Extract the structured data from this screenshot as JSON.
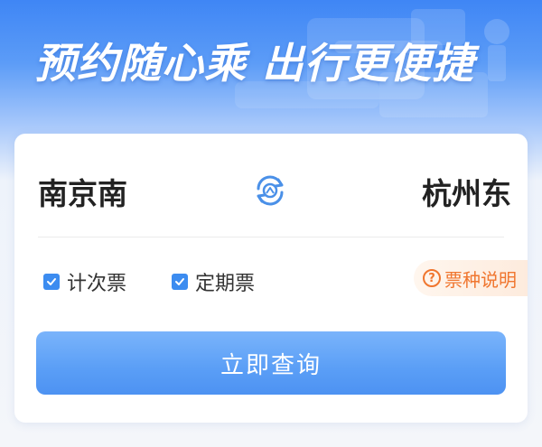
{
  "hero": {
    "title": "预约随心乘 出行更便捷"
  },
  "route": {
    "from_station": "南京南",
    "to_station": "杭州东",
    "swap_icon": "swap-stations-icon"
  },
  "ticket_types": [
    {
      "label": "计次票",
      "checked": true
    },
    {
      "label": "定期票",
      "checked": true
    }
  ],
  "ticket_info": {
    "label": "票种说明",
    "icon": "question-circle-icon"
  },
  "query_button": {
    "label": "立即查询"
  },
  "colors": {
    "brand_blue": "#3c8cf0",
    "info_orange": "#f0762f",
    "button_blue": "#5a9ef6"
  }
}
